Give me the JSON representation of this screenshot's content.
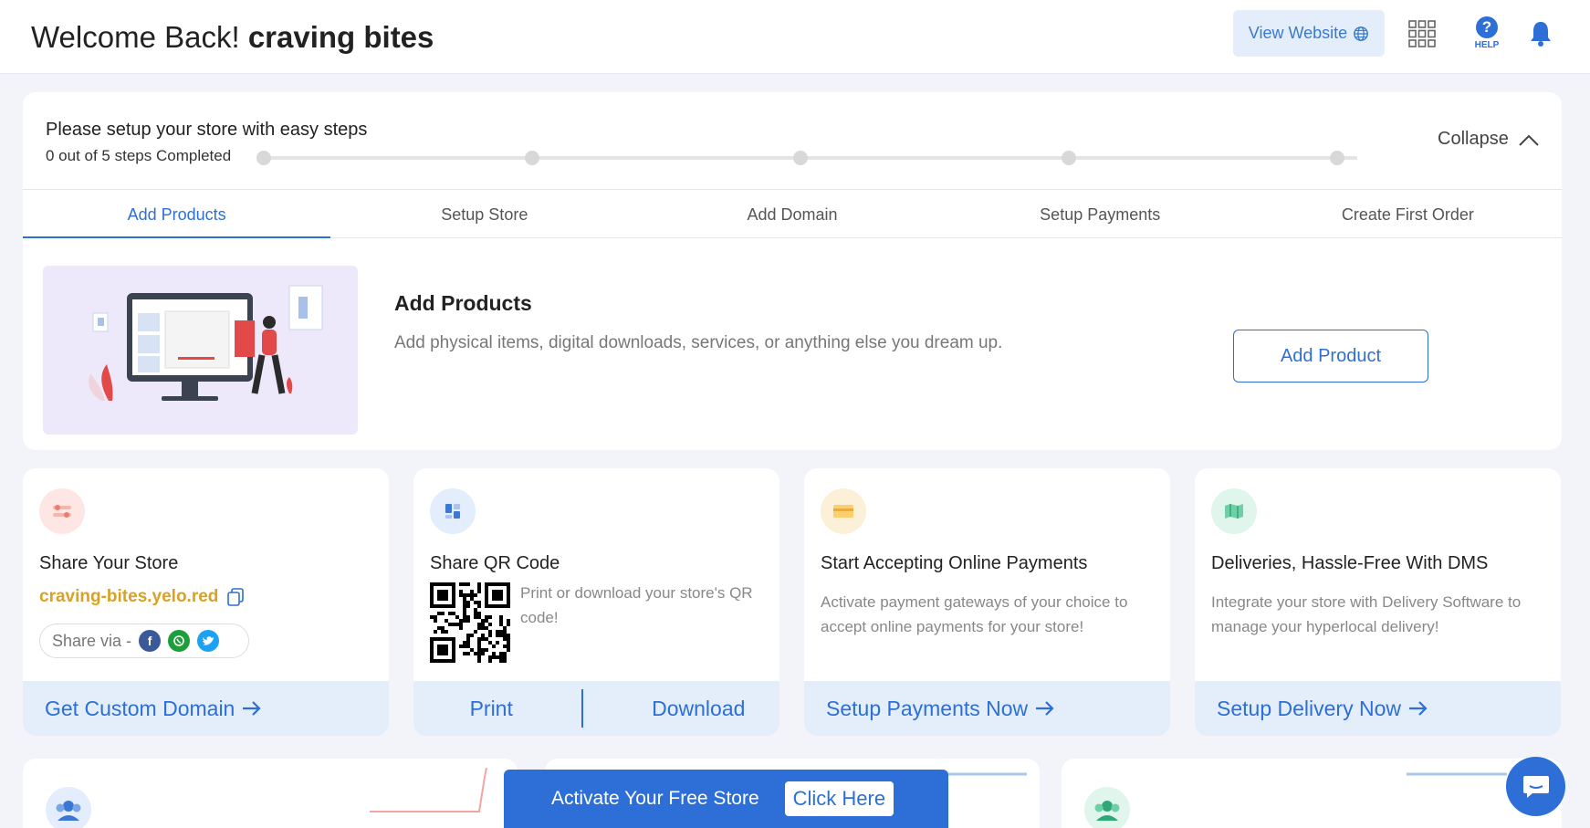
{
  "header": {
    "welcome_prefix": "Welcome Back!",
    "store_name": "craving bites",
    "view_website_label": "View Website",
    "help_label": "HELP",
    "help_glyph": "?"
  },
  "setup": {
    "title": "Please setup your store with easy steps",
    "progress_text": "0 out of 5 steps Completed",
    "steps_completed": 0,
    "steps_total": 5,
    "collapse_label": "Collapse",
    "tabs": [
      {
        "label": "Add Products",
        "active": true
      },
      {
        "label": "Setup Store",
        "active": false
      },
      {
        "label": "Add Domain",
        "active": false
      },
      {
        "label": "Setup Payments",
        "active": false
      },
      {
        "label": "Create First Order",
        "active": false
      }
    ],
    "current_step": {
      "title": "Add Products",
      "description": "Add physical items, digital downloads, services, or anything else you dream up.",
      "button_label": "Add Product"
    }
  },
  "cards": {
    "share_store": {
      "title": "Share Your Store",
      "url": "craving-bites.yelo.red",
      "share_via_label": "Share via -",
      "footer_label": "Get Custom Domain",
      "icon": "toggle-settings-icon"
    },
    "qr_code": {
      "title": "Share QR Code",
      "description": "Print or download your store's QR code!",
      "print_label": "Print",
      "download_label": "Download",
      "icon": "layout-grid-icon"
    },
    "payments": {
      "title": "Start Accepting Online Payments",
      "description": "Activate payment gateways of your choice to accept online payments for your store!",
      "footer_label": "Setup Payments Now",
      "icon": "credit-card-icon"
    },
    "delivery": {
      "title": "Deliveries, Hassle-Free With DMS",
      "description": "Integrate your store with Delivery Software to manage your hyperlocal delivery!",
      "footer_label": "Setup Delivery Now",
      "icon": "map-icon"
    }
  },
  "activate_banner": {
    "text": "Activate Your Free Store",
    "button_label": "Click Here"
  },
  "colors": {
    "accent": "#2d6fd6",
    "url_gold": "#d9a223",
    "light_blue": "#e3eefa"
  }
}
